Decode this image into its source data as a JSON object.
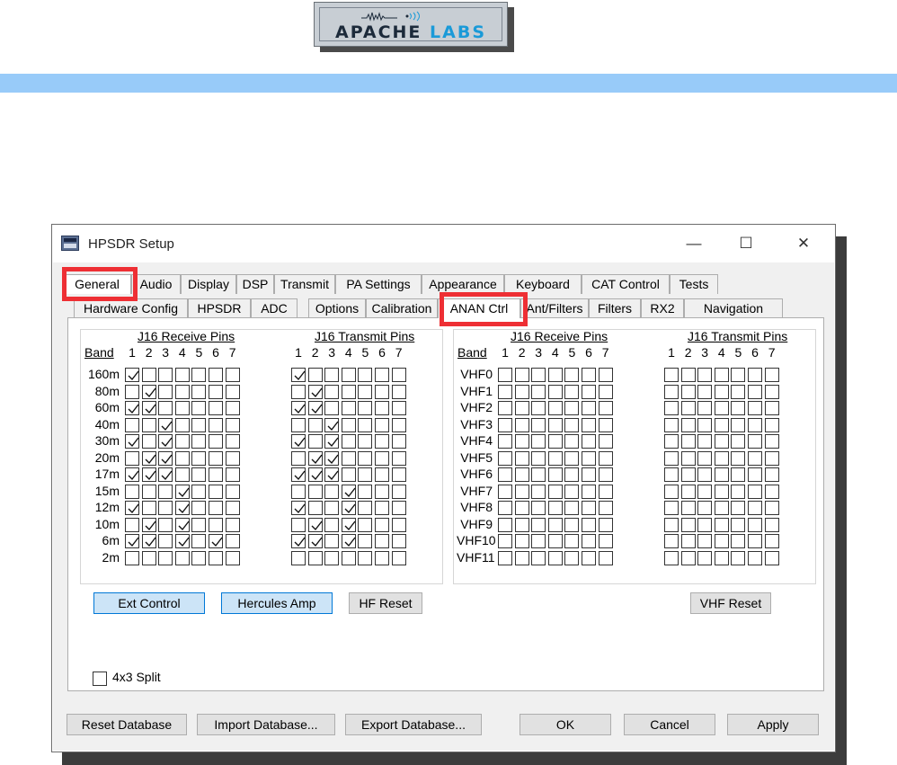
{
  "banner": {
    "logo_word1": "APACHE",
    "logo_word2": "LABS",
    "bar_color": "#98cbf9"
  },
  "window": {
    "title": "HPSDR Setup",
    "minimize": "—",
    "maximize": "☐",
    "close": "✕"
  },
  "tabs_row1": [
    "General",
    "Audio",
    "Display",
    "DSP",
    "Transmit",
    "PA Settings",
    "Appearance",
    "Keyboard",
    "CAT Control",
    "Tests"
  ],
  "tabs_row2": [
    "Hardware Config",
    "HPSDR",
    "ADC",
    "Options",
    "Calibration",
    "ANAN Ctrl",
    "Ant/Filters",
    "Filters",
    "RX2",
    "Navigation"
  ],
  "active_tabs": {
    "row1": "General",
    "row2": "ANAN Ctrl"
  },
  "highlight_color": "#ee2f34",
  "hf": {
    "band_header": "Band",
    "receive_title": "J16 Receive Pins",
    "transmit_title": "J16 Transmit Pins",
    "pin_numbers": [
      "1",
      "2",
      "3",
      "4",
      "5",
      "6",
      "7"
    ],
    "bands": [
      "160m",
      "80m",
      "60m",
      "40m",
      "30m",
      "20m",
      "17m",
      "15m",
      "12m",
      "10m",
      "6m",
      "2m"
    ],
    "receive": [
      [
        1,
        0,
        0,
        0,
        0,
        0,
        0
      ],
      [
        0,
        1,
        0,
        0,
        0,
        0,
        0
      ],
      [
        1,
        1,
        0,
        0,
        0,
        0,
        0
      ],
      [
        0,
        0,
        1,
        0,
        0,
        0,
        0
      ],
      [
        1,
        0,
        1,
        0,
        0,
        0,
        0
      ],
      [
        0,
        1,
        1,
        0,
        0,
        0,
        0
      ],
      [
        1,
        1,
        1,
        0,
        0,
        0,
        0
      ],
      [
        0,
        0,
        0,
        1,
        0,
        0,
        0
      ],
      [
        1,
        0,
        0,
        1,
        0,
        0,
        0
      ],
      [
        0,
        1,
        0,
        1,
        0,
        0,
        0
      ],
      [
        1,
        1,
        0,
        1,
        0,
        1,
        0
      ],
      [
        0,
        0,
        0,
        0,
        0,
        0,
        0
      ]
    ],
    "transmit": [
      [
        1,
        0,
        0,
        0,
        0,
        0,
        0
      ],
      [
        0,
        1,
        0,
        0,
        0,
        0,
        0
      ],
      [
        1,
        1,
        0,
        0,
        0,
        0,
        0
      ],
      [
        0,
        0,
        1,
        0,
        0,
        0,
        0
      ],
      [
        1,
        0,
        1,
        0,
        0,
        0,
        0
      ],
      [
        0,
        1,
        1,
        0,
        0,
        0,
        0
      ],
      [
        1,
        1,
        1,
        0,
        0,
        0,
        0
      ],
      [
        0,
        0,
        0,
        1,
        0,
        0,
        0
      ],
      [
        1,
        0,
        0,
        1,
        0,
        0,
        0
      ],
      [
        0,
        1,
        0,
        1,
        0,
        0,
        0
      ],
      [
        1,
        1,
        0,
        1,
        0,
        0,
        0
      ],
      [
        0,
        0,
        0,
        0,
        0,
        0,
        0
      ]
    ]
  },
  "vhf": {
    "band_header": "Band",
    "receive_title": "J16 Receive Pins",
    "transmit_title": "J16 Transmit Pins",
    "pin_numbers": [
      "1",
      "2",
      "3",
      "4",
      "5",
      "6",
      "7"
    ],
    "bands": [
      "VHF0",
      "VHF1",
      "VHF2",
      "VHF3",
      "VHF4",
      "VHF5",
      "VHF6",
      "VHF7",
      "VHF8",
      "VHF9",
      "VHF10",
      "VHF11"
    ]
  },
  "buttons": {
    "ext_control": "Ext Control",
    "hercules_amp": "Hercules Amp",
    "hf_reset": "HF Reset",
    "vhf_reset": "VHF Reset"
  },
  "split": {
    "label": "4x3 Split",
    "checked": false
  },
  "footer": {
    "reset_db": "Reset Database",
    "import_db": "Import Database...",
    "export_db": "Export Database...",
    "ok": "OK",
    "cancel": "Cancel",
    "apply": "Apply"
  }
}
